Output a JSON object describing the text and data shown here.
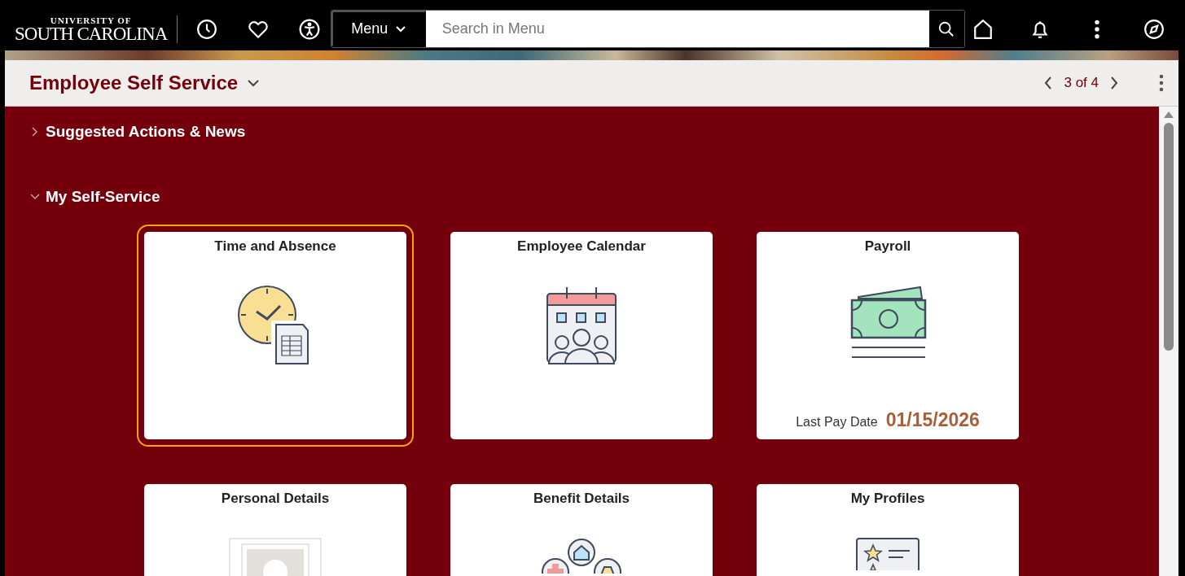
{
  "header": {
    "logo": {
      "line_1": "UNIVERSITY OF",
      "line_2": "SOUTH CAROLINA"
    },
    "menu_button": "Menu",
    "search": {
      "placeholder": "Search in Menu"
    }
  },
  "title_bar": {
    "title": "Employee Self Service",
    "pager": "3 of 4"
  },
  "sections": [
    {
      "title": "Suggested Actions & News",
      "expanded": false
    },
    {
      "title": "My Self-Service",
      "expanded": true,
      "tiles": [
        {
          "title": "Time and Absence",
          "focused": true
        },
        {
          "title": "Employee Calendar",
          "focused": false
        },
        {
          "title": "Payroll",
          "focused": false,
          "detail": {
            "label": "Last Pay Date",
            "value": "01/15/2026"
          }
        },
        {
          "title": "Personal Details",
          "focused": false
        },
        {
          "title": "Benefit Details",
          "focused": false
        },
        {
          "title": "My Profiles",
          "focused": false
        }
      ]
    }
  ]
}
